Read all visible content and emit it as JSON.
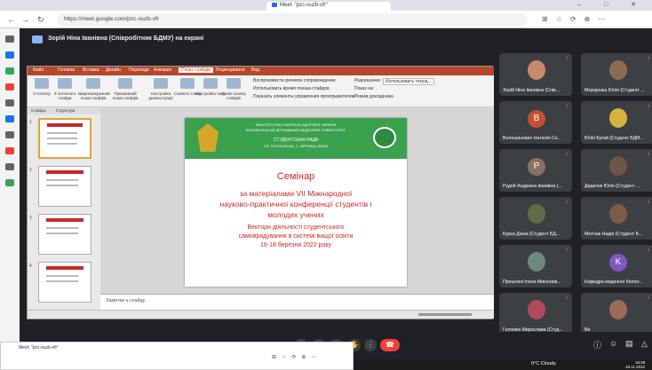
{
  "browser": {
    "tab_title": "Meet: \"pzc-ouzb-vfr\"",
    "url": "https://meet.google.com/pzc-ouzb-vfr",
    "window_controls": "– □ ✕"
  },
  "meet": {
    "presenter_label": "Зорій Ніна Іванівна (Співробітник БДМУ) на екрані"
  },
  "ppt": {
    "tabs": [
      "Файл",
      "Головна",
      "Вставка",
      "Дизайн",
      "Переходи",
      "Анімація",
      "Показ слайдів",
      "Рецензування",
      "Вид"
    ],
    "active_tab": "Показ слайдів",
    "ribbon_buttons": [
      "З початку",
      "З поточного слайда",
      "Широкоекранний показ слайдів",
      "Прихований показ слайдів",
      "Настройка демонстрації",
      "Сховати слайд",
      "Настройка часу",
      "Запис показу слайдів"
    ],
    "checkboxes": [
      "Воспроизвести речевое сопровождение",
      "Использовать время показа слайдов",
      "Показать элементы управления проигрывателем"
    ],
    "monitor_label": "Разрешение:",
    "monitor_value": "Использовать текущ...",
    "monitor_checks": [
      "Показ на:",
      "Режим докладчика"
    ],
    "thumb_tabs": [
      "Слайды",
      "Структура"
    ],
    "slide_numbers": [
      "1",
      "2",
      "3",
      "4"
    ],
    "notes_placeholder": "Заметки к слайду"
  },
  "slide": {
    "banner_lines": [
      "МІНІСТЕРСТВО ОХОРОНИ ЗДОРОВ'Я УКРАЇНИ",
      "БУКОВИНСЬКИЙ ДЕРЖАВНИЙ МЕДИЧНИЙ УНІВЕРСИТЕТ",
      "СТУДЕНТСЬКА РАДА",
      "ПЛ. ТЕАТРАЛЬНА, 2, ЧЕРНІВЦІ, 58002"
    ],
    "title": "Семінар",
    "lines": [
      "за матеріалами VII Міжнародної",
      "науково-практичної конференції студентів і",
      "молодих учених"
    ],
    "sub_lines": [
      "Вектори діяльності студентського",
      "самоврядування в системі вищої освіти",
      "16-18 березня 2022 року"
    ]
  },
  "participants": [
    {
      "name": "Зорій Ніна Іванівна (Спів...",
      "type": "photo",
      "color": "#c98a6b"
    },
    {
      "name": "Морархаш Юлія (Студент ...",
      "type": "photo",
      "color": "#8a6b52"
    },
    {
      "name": "Волошинович Наталія Се...",
      "type": "letter",
      "letter": "B",
      "color": "#c5502e"
    },
    {
      "name": "Юлія Бугай (Студент БДМ...",
      "type": "photo",
      "color": "#d6b23e"
    },
    {
      "name": "Рудой Андріана Іванівна (...",
      "type": "letter",
      "letter": "P",
      "color": "#8d6e63"
    },
    {
      "name": "Дидичок Юлія (Студент ...",
      "type": "photo",
      "color": "#6d5646"
    },
    {
      "name": "Курка Діана (Студент БД...",
      "type": "photo",
      "color": "#5f6b4a"
    },
    {
      "name": "Мегічак Надія (Студент Б...",
      "type": "photo",
      "color": "#7a5c48"
    },
    {
      "name": "Прешлюк Ілона Миколаїв...",
      "type": "photo",
      "color": "#6b8a7a"
    },
    {
      "name": "Кафедра медичної біолог...",
      "type": "letter",
      "letter": "K",
      "color": "#7e57c2"
    },
    {
      "name": "Голомиз Мирослава (Студ...",
      "type": "photo",
      "color": "#b04a5a"
    },
    {
      "name": "Ви",
      "type": "photo",
      "color": "#9c6a5a"
    }
  ],
  "mini_window": {
    "tab_title": "Meet: \"pzc-ouzb-vfr\""
  },
  "taskbar": {
    "weather": "0°C Cloudy",
    "time": "16:28",
    "date": "16.11.2022"
  }
}
